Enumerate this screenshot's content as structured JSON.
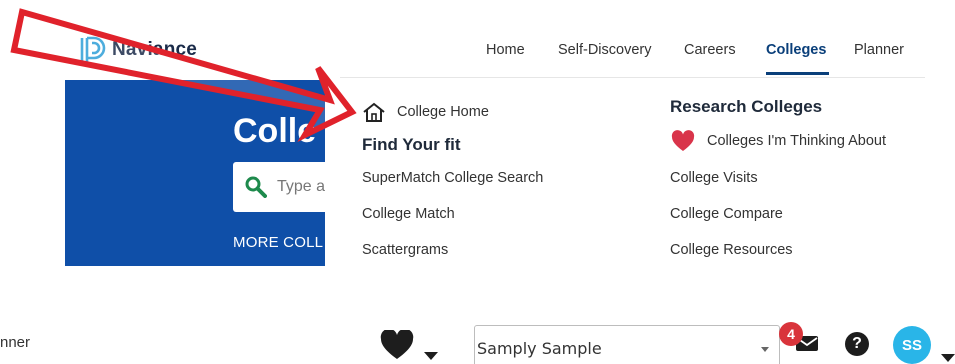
{
  "brand": {
    "name": "Naviance",
    "logo_color": "#2e9fd8"
  },
  "nav": {
    "items": [
      {
        "label": "Home"
      },
      {
        "label": "Self-Discovery"
      },
      {
        "label": "Careers"
      },
      {
        "label": "Colleges",
        "active": true
      },
      {
        "label": "Planner"
      }
    ],
    "active_color": "#0a3f7a"
  },
  "hero": {
    "title": "Colle",
    "search_placeholder": "Type a",
    "more_link": "MORE COLL",
    "background": "#0f4fa8"
  },
  "menu": {
    "home_link": "College Home",
    "find_fit": {
      "heading": "Find Your fit",
      "links": [
        "SuperMatch College Search",
        "College Match",
        "Scattergrams"
      ]
    },
    "research": {
      "heading": "Research Colleges",
      "favorites_link": "Colleges I'm Thinking About",
      "links": [
        "College Visits",
        "College Compare",
        "College Resources"
      ]
    }
  },
  "footer_bar": {
    "left_text": "nner",
    "student_select_value": "Samply Sample",
    "mail_badge_count": "4",
    "help_label": "?",
    "avatar_initials": "SS",
    "avatar_color": "#29b5e8",
    "badge_color": "#d9343b"
  },
  "annotation": {
    "arrow_color": "#e0222b"
  }
}
